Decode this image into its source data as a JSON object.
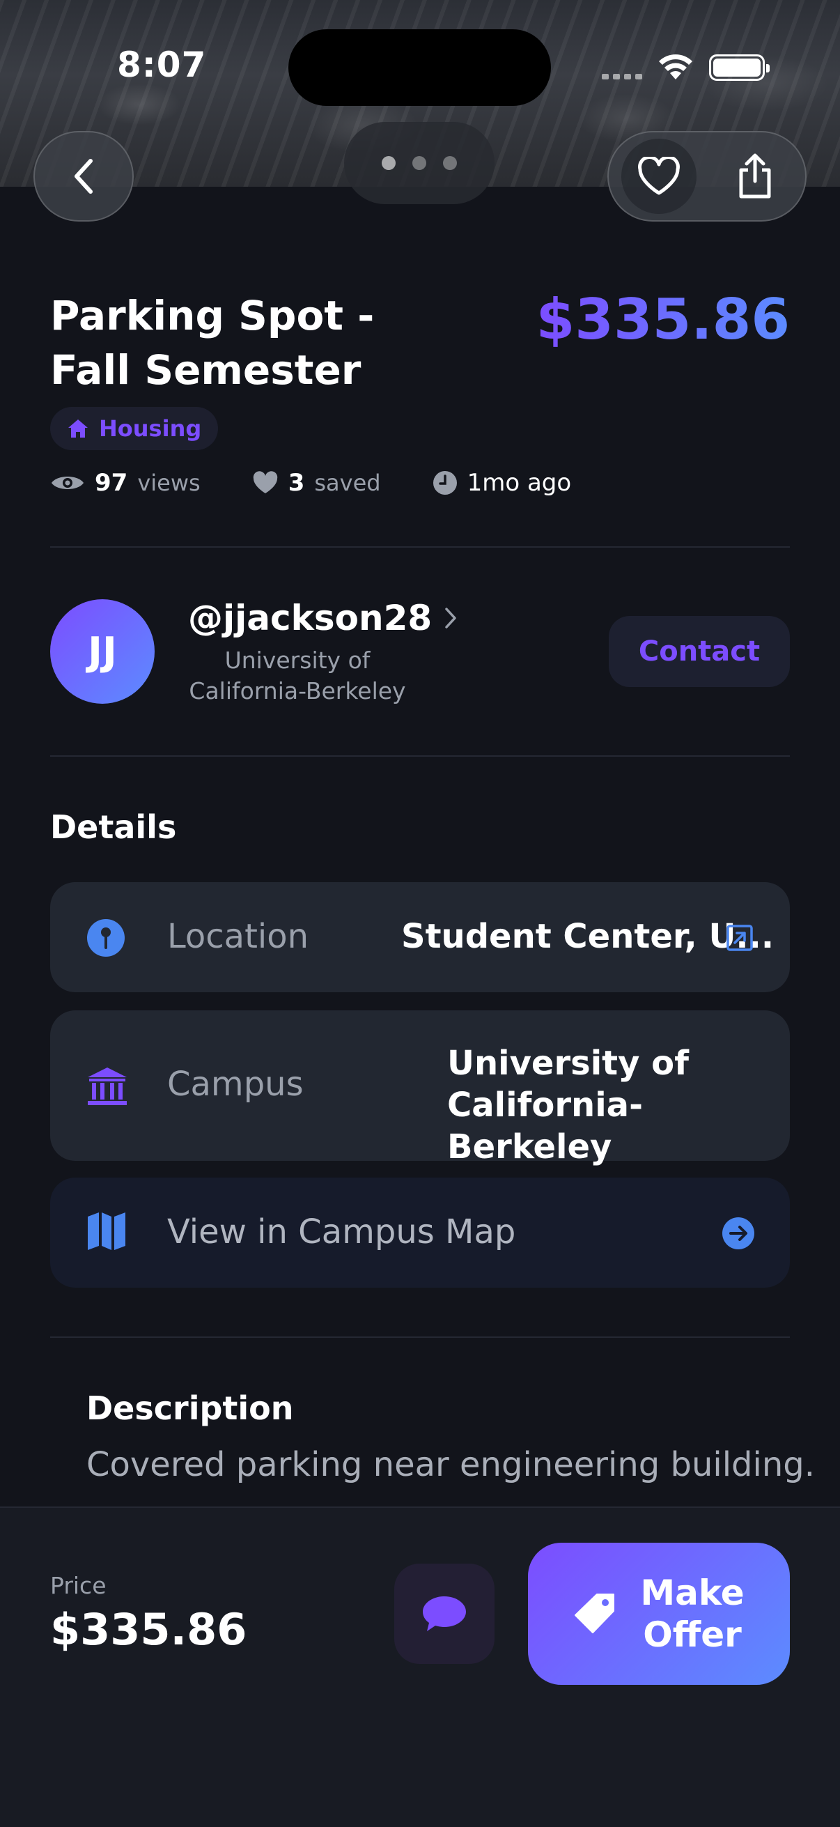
{
  "status_bar": {
    "time": "8:07"
  },
  "header": {
    "back_icon": "chevron-left-icon",
    "favorite_icon": "heart-outline-icon",
    "share_icon": "share-icon",
    "pager_count": 3,
    "pager_active": 1
  },
  "listing": {
    "title": "Parking Spot - Fall Semester",
    "price": "$335.86",
    "category": {
      "label": "Housing",
      "icon": "house-icon"
    },
    "stats": {
      "views_count": "97",
      "views_label": "views",
      "saved_count": "3",
      "saved_label": "saved",
      "posted": "1mo ago"
    }
  },
  "seller": {
    "initials": "JJ",
    "username": "@jjackson28",
    "school": "University of California-Berkeley",
    "contact_label": "Contact"
  },
  "details": {
    "title": "Details",
    "location": {
      "label": "Location",
      "value": "Student Center, U...",
      "icon": "map-pin-icon"
    },
    "campus": {
      "label": "Campus",
      "value": "University of California-Berkeley",
      "icon": "university-icon"
    },
    "map_link": {
      "label": "View in Campus Map",
      "icon": "map-icon"
    }
  },
  "description": {
    "title": "Description",
    "text": "Covered parking near engineering building."
  },
  "footer": {
    "price_label": "Price",
    "price_value": "$335.86",
    "make_offer_label": "Make Offer"
  },
  "colors": {
    "accent_purple": "#7c4dff",
    "accent_blue": "#5c8cff",
    "background": "#12141b",
    "card": "#222731"
  }
}
